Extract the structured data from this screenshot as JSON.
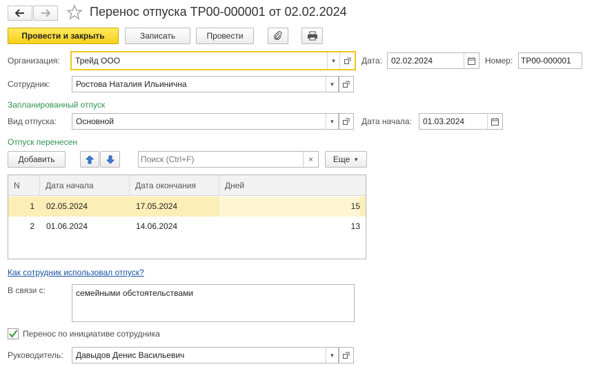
{
  "header": {
    "title": "Перенос отпуска ТР00-000001 от 02.02.2024"
  },
  "toolbar": {
    "post_close": "Провести и закрыть",
    "save": "Записать",
    "post": "Провести"
  },
  "form": {
    "org_label": "Организация:",
    "org_value": "Трейд ООО",
    "date_label": "Дата:",
    "date_value": "02.02.2024",
    "number_label": "Номер:",
    "number_value": "ТР00-000001",
    "employee_label": "Сотрудник:",
    "employee_value": "Ростова Наталия Ильинична",
    "planned_title": "Запланированный отпуск",
    "vacation_type_label": "Вид отпуска:",
    "vacation_type_value": "Основной",
    "start_date_label": "Дата начала:",
    "start_date_value": "01.03.2024",
    "moved_title": "Отпуск перенесен"
  },
  "table_toolbar": {
    "add": "Добавить",
    "search_placeholder": "Поиск (Ctrl+F)",
    "more": "Еще"
  },
  "table": {
    "columns": [
      "N",
      "Дата начала",
      "Дата окончания",
      "Дней"
    ],
    "rows": [
      {
        "n": "1",
        "start": "02.05.2024",
        "end": "17.05.2024",
        "days": "15"
      },
      {
        "n": "2",
        "start": "01.06.2024",
        "end": "14.06.2024",
        "days": "13"
      }
    ]
  },
  "footer": {
    "usage_link": "Как сотрудник использовал отпуск?",
    "reason_label": "В связи с:",
    "reason_value": "семейными обстоятельствами",
    "initiative_label": "Перенос по инициативе сотрудника",
    "initiative_checked": true,
    "manager_label": "Руководитель:",
    "manager_value": "Давыдов Денис Васильевич"
  },
  "colors": {
    "primary_button": "#f6cf1b",
    "group_title": "#2f9550",
    "link": "#1c55a5",
    "selected_row": "#fbeeb6",
    "active_field_border": "#f0c419"
  }
}
